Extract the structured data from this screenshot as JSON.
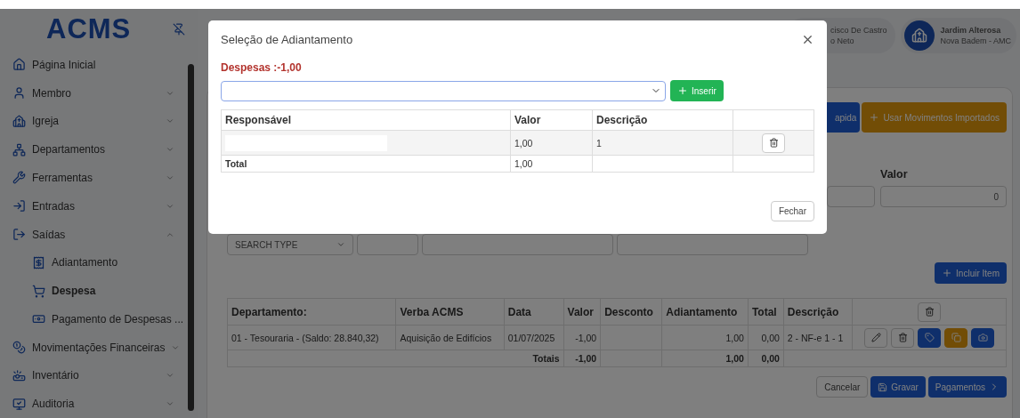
{
  "sidebar": {
    "logo": "ACMS",
    "items": [
      {
        "kind": "link",
        "label": "Página Inicial"
      },
      {
        "kind": "group",
        "label": "Membro",
        "expanded": false
      },
      {
        "kind": "group",
        "label": "Igreja",
        "expanded": false
      },
      {
        "kind": "group",
        "label": "Departamentos",
        "expanded": false
      },
      {
        "kind": "group",
        "label": "Ferramentas",
        "expanded": false
      },
      {
        "kind": "group",
        "label": "Entradas",
        "expanded": false
      },
      {
        "kind": "group",
        "label": "Saídas",
        "expanded": true,
        "children": [
          {
            "label": "Adiantamento",
            "selected": false
          },
          {
            "label": "Despesa",
            "selected": true
          },
          {
            "label": "Pagamento de Despesas ...",
            "selected": false
          }
        ]
      },
      {
        "kind": "group",
        "label": "Movimentações Financeiras",
        "expanded": false
      },
      {
        "kind": "group",
        "label": "Inventário",
        "expanded": false
      },
      {
        "kind": "group",
        "label": "Auditoria",
        "expanded": false
      }
    ]
  },
  "header": {
    "users": [
      {
        "name": "cisco De Castro",
        "subtitle": "o Neto"
      },
      {
        "name": "Jardim Alterosa",
        "subtitle": "Nova Badem - AMC"
      }
    ]
  },
  "form": {
    "buttons": [
      {
        "label": "apida",
        "kind": "primary"
      },
      {
        "label": "Usar Movimentos Importados",
        "kind": "warning"
      }
    ],
    "value_field": {
      "label": "Valor",
      "value": "0"
    },
    "search_type": {
      "placeholder": "SEARCH TYPE"
    },
    "add_item": "Incluir Item"
  },
  "items_table": {
    "columns": [
      "Departamento:",
      "Verba ACMS",
      "Data",
      "Valor",
      "Desconto",
      "Adiantamento",
      "Total",
      "Descrição"
    ],
    "rows": [
      {
        "departamento": "01 - Tesouraria - (Saldo: 28.840,32)",
        "verba": "Aquisição de Edifícios",
        "data": "01/07/2025",
        "valor": "-1,00",
        "desconto": "",
        "adiantamento": "1,00",
        "total": "0,00",
        "descricao": "2 - NF-e 1 - 1"
      }
    ],
    "totals": {
      "label": "Totais",
      "valor": "-1,00",
      "adiantamento": "1,00",
      "total": "0,00"
    }
  },
  "footer_buttons": [
    {
      "label": "Cancelar",
      "kind": "secondary"
    },
    {
      "label": "Gravar",
      "kind": "primary"
    },
    {
      "label": "Pagamentos",
      "kind": "primary"
    }
  ],
  "modal": {
    "title": "Seleção de Adiantamento",
    "summary": "Despesas :-1,00",
    "insert_button": "Inserir",
    "columns": [
      "Responsável",
      "Valor",
      "Descrição"
    ],
    "rows": [
      {
        "responsavel_redacted": true,
        "valor": "1,00",
        "descricao": "1"
      }
    ],
    "total": {
      "label": "Total",
      "valor": "1,00"
    },
    "close_button": "Fechar"
  }
}
